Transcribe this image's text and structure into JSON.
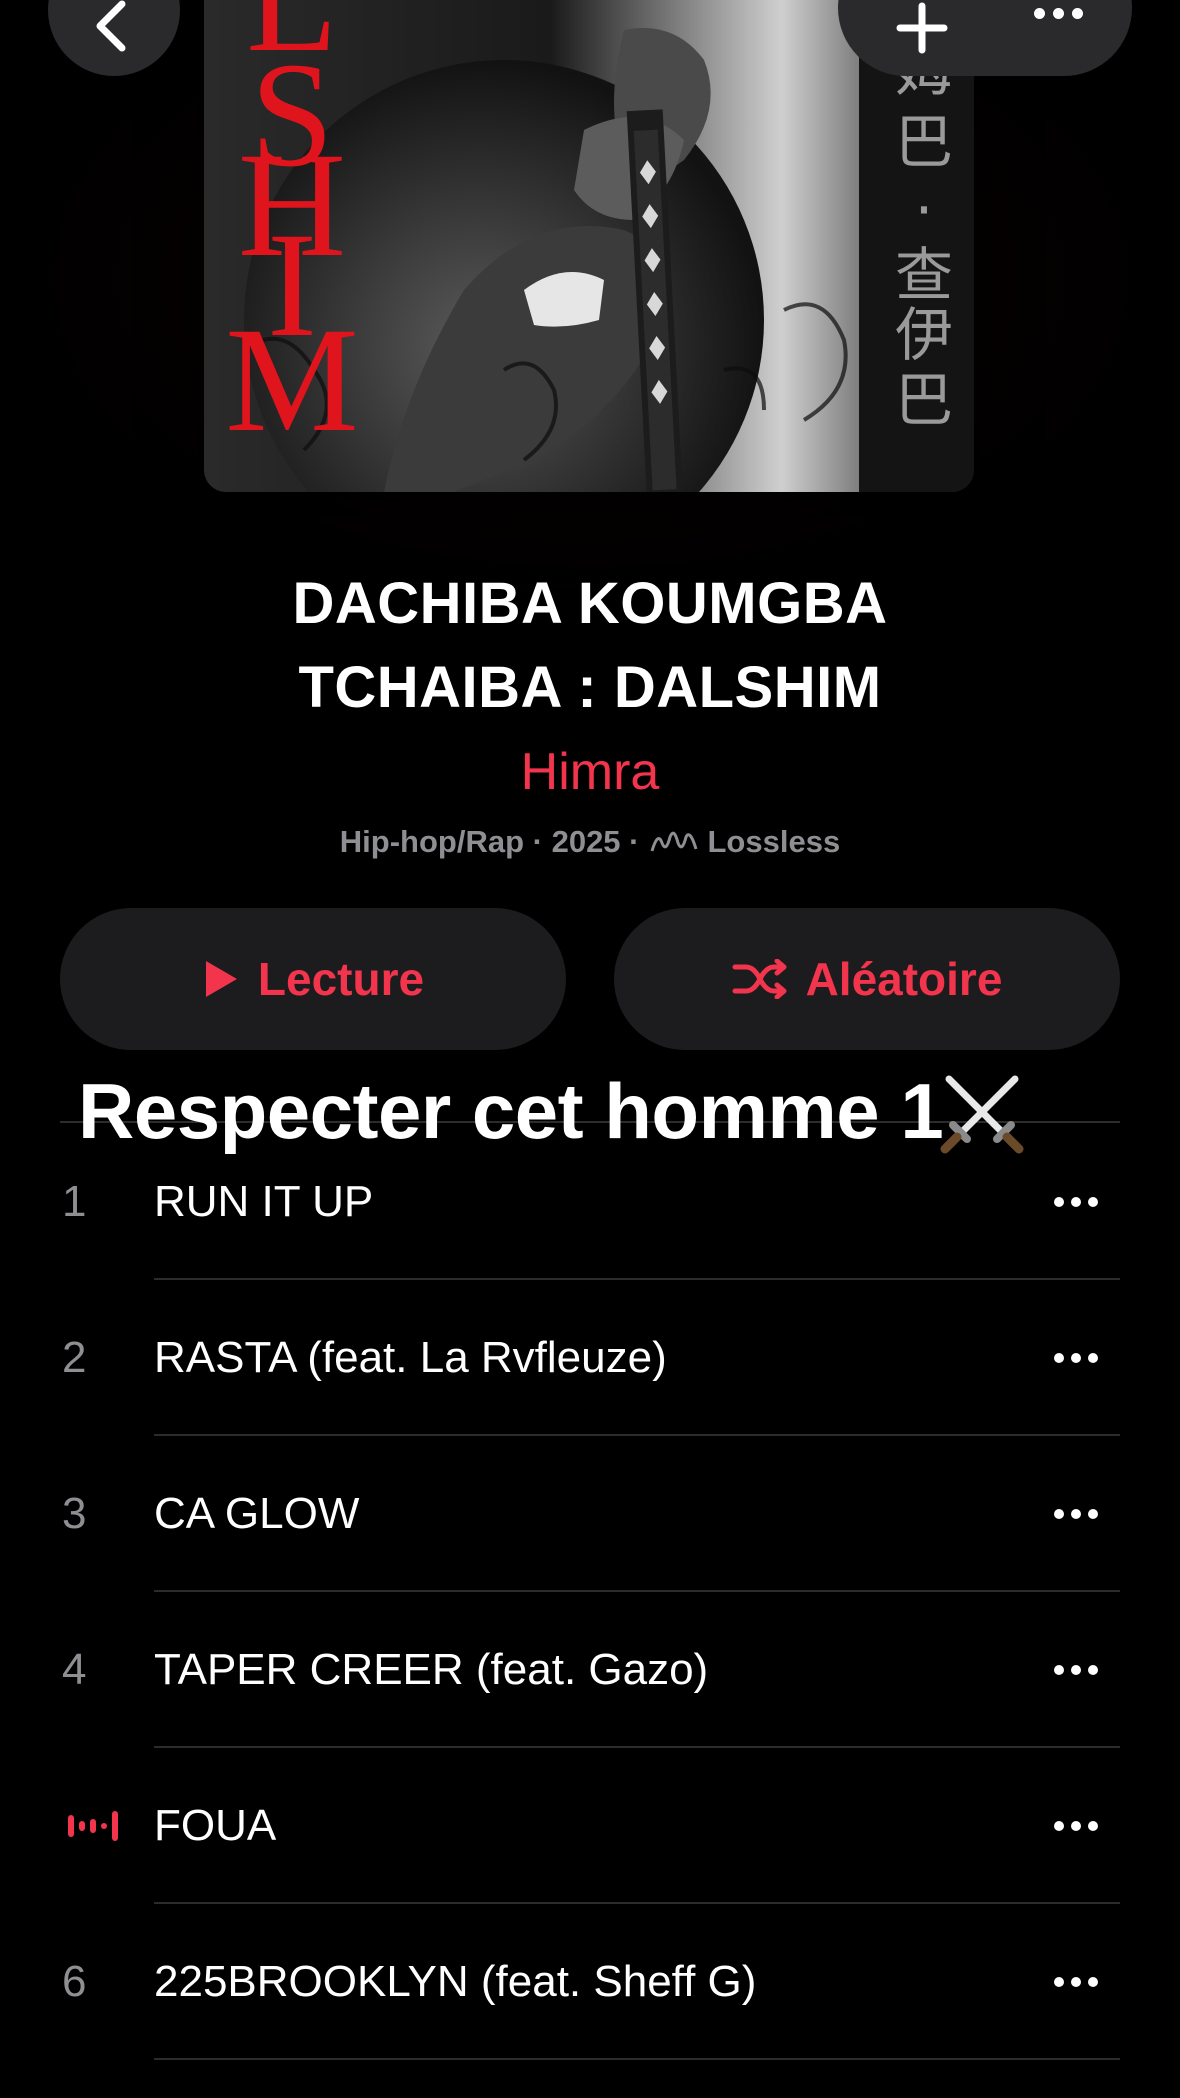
{
  "album": {
    "title_line1": "DACHIBA KOUMGBA",
    "title_line2": "TCHAIBA : DALSHIM",
    "artist": "Himra",
    "meta_genre_year": "Hip-hop/Rap · 2025 ·",
    "meta_quality": "Lossless",
    "artwork_text_red": [
      "L",
      "S",
      "H",
      "I",
      "M"
    ],
    "artwork_text_side": [
      "姆",
      "巴",
      "·",
      "查",
      "伊",
      "巴"
    ]
  },
  "buttons": {
    "play_label": "Lecture",
    "shuffle_label": "Aléatoire"
  },
  "caption": {
    "text": "Respecter cet homme 1"
  },
  "tracks": [
    {
      "number": "1",
      "title": "RUN IT UP",
      "playing": false
    },
    {
      "number": "2",
      "title": "RASTA (feat. La Rvfleuze)",
      "playing": false
    },
    {
      "number": "3",
      "title": "CA GLOW",
      "playing": false
    },
    {
      "number": "4",
      "title": "TAPER CREER (feat. Gazo)",
      "playing": false
    },
    {
      "number": "",
      "title": "FOUA",
      "playing": true
    },
    {
      "number": "6",
      "title": "225BROOKLYN (feat. Sheff G)",
      "playing": false
    }
  ],
  "colors": {
    "accent": "#f2344d",
    "background": "#000000",
    "button_bg": "#1c1c1e",
    "secondary_text": "#8e8e93"
  }
}
